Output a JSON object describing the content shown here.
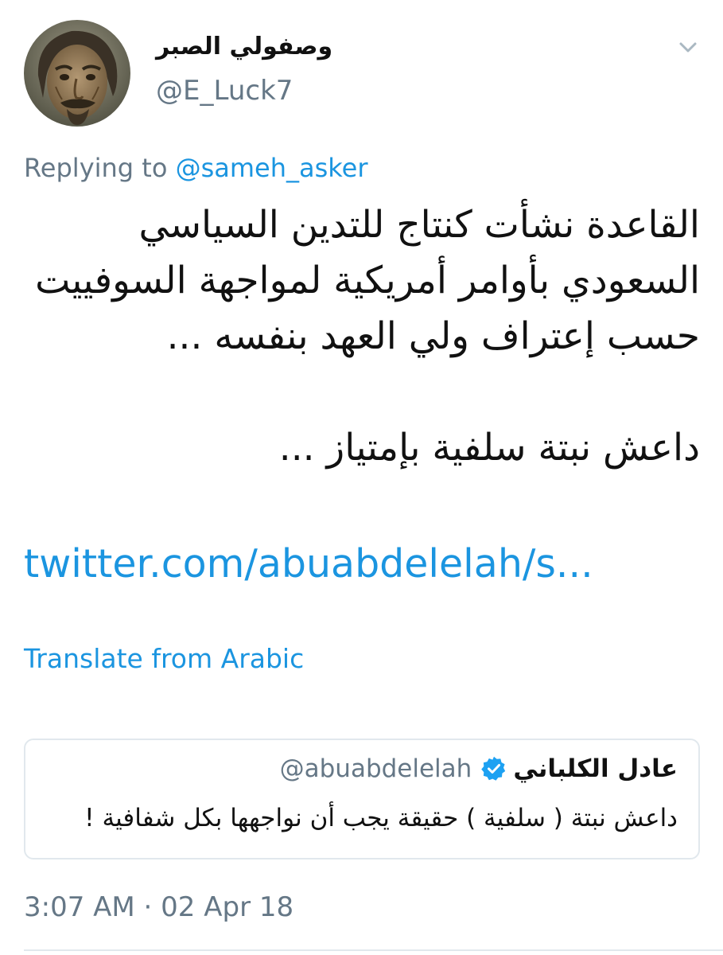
{
  "author": {
    "display_name": "وصفولي الصبر",
    "handle": "@E_Luck7"
  },
  "reply": {
    "prefix": "Replying to",
    "mention": "@sameh_asker"
  },
  "tweet": {
    "lines": [
      "القاعدة نشأت كنتاج للتدين السياسي",
      "السعودي بأوامر أمريكية لمواجهة السوفييت",
      "حسب إعتراف ولي العهد بنفسه ...",
      "داعش نبتة سلفية بإمتياز ..."
    ],
    "link": "twitter.com/abuabdelelah/s...",
    "translate": "Translate from Arabic"
  },
  "quote": {
    "name": "عادل الكلباني",
    "handle": "@abuabdelelah",
    "text": "داعش نبتة ( سلفية ) حقيقة يجب أن نواجهها بكل شفافية !"
  },
  "timestamp": "3:07 AM · 02 Apr 18",
  "colors": {
    "link": "#1b95e0",
    "secondary_text": "#657786",
    "border": "#e1e8ed"
  }
}
